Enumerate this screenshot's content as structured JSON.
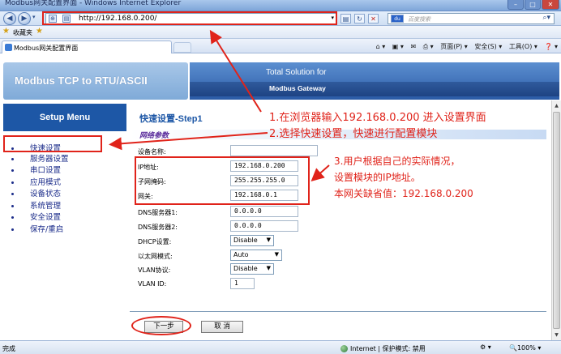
{
  "window": {
    "title": "Modbus网关配置界面 - Windows Internet Explorer"
  },
  "browser": {
    "address": "http://192.168.0.200/",
    "search_placeholder": "百度搜索",
    "favorites_label": "收藏夹",
    "tab_title": "Modbus网关配置界面",
    "commands": [
      "页面(P) ▾",
      "安全(S) ▾",
      "工具(O) ▾",
      "❓ ▾"
    ],
    "status": "完成",
    "zone": "Internet | 保护模式: 禁用",
    "zoom": "🔍100% ▾"
  },
  "header": {
    "product": "Modbus TCP to RTU/ASCII",
    "tagline": "Total Solution for",
    "subtitle": "Modbus Gateway"
  },
  "sidebar": {
    "title": "Setup Menu",
    "items": [
      "快速设置",
      "服务器设置",
      "串口设置",
      "应用模式",
      "设备状态",
      "系统管理",
      "安全设置",
      "保存/重启"
    ]
  },
  "content": {
    "step_title": "快速设置-Step1",
    "section": "网络参数",
    "fields": [
      {
        "label": "设备名称:",
        "value": ""
      },
      {
        "label": "IP地址:",
        "value": "192.168.0.200"
      },
      {
        "label": "子网掩码:",
        "value": "255.255.255.0"
      },
      {
        "label": "网关:",
        "value": "192.168.0.1"
      },
      {
        "label": "DNS服务器1:",
        "value": "0.0.0.0"
      },
      {
        "label": "DNS服务器2:",
        "value": "0.0.0.0"
      }
    ],
    "selects": [
      {
        "label": "DHCP设置:",
        "value": "Disable"
      },
      {
        "label": "以太网模式:",
        "value": "Auto"
      },
      {
        "label": "VLAN协议:",
        "value": "Disable"
      }
    ],
    "vlan_id_label": "VLAN ID:",
    "vlan_id_value": "1",
    "next_button": "下一步",
    "cancel_button": "取 消"
  },
  "annotations": {
    "a1": "1.在浏览器输入192.168.0.200 进入设置界面",
    "a2": "2.选择快速设置，快速进行配置模块",
    "a3_line1": "3.用户根据自己的实际情况，",
    "a3_line2": "设置模块的IP地址。",
    "a3_line3": "本网关缺省值：192.168.0.200"
  },
  "colors": {
    "annotation": "#e0231a",
    "menu_blue": "#1d57a6",
    "link_blue": "#1b2c8a"
  }
}
